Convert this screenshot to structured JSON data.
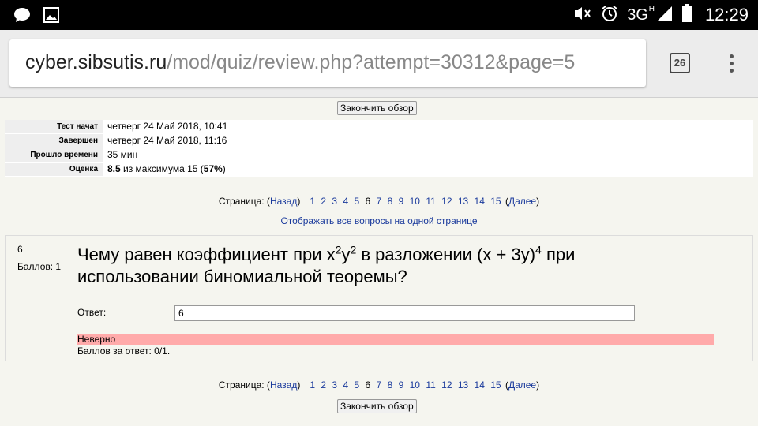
{
  "statusbar": {
    "network": "3G",
    "network_sup": "H",
    "battery": "16",
    "time": "12:29",
    "icons": [
      "message-icon",
      "image-icon",
      "mute-icon",
      "alarm-icon",
      "signal-icon",
      "battery-icon"
    ]
  },
  "browser": {
    "url_host": "cyber.sibsutis.ru",
    "url_path": "/mod/quiz/review.php?attempt=30312&page=5",
    "tabs_count": "26"
  },
  "quiz": {
    "finish_review": "Закончить обзор",
    "summary": [
      {
        "key": "Тест начат",
        "value": "четверг 24 Май 2018, 10:41"
      },
      {
        "key": "Завершен",
        "value": "четверг 24 Май 2018, 11:16"
      },
      {
        "key": "Прошло времени",
        "value": "35 мин"
      }
    ],
    "grade_key": "Оценка",
    "grade_score": "8.5",
    "grade_text_mid": " из максимума 15 (",
    "grade_percent": "57%",
    "grade_text_end": ")",
    "pager": {
      "label": "Страница: (",
      "prev": "Назад",
      "next": "Далее",
      "close_paren": ")",
      "open_paren": " (",
      "pages": [
        "1",
        "2",
        "3",
        "4",
        "5",
        "6",
        "7",
        "8",
        "9",
        "10",
        "11",
        "12",
        "13",
        "14",
        "15"
      ],
      "current": "6"
    },
    "show_all": "Отображать все вопросы на одной странице",
    "question": {
      "number": "6",
      "marks": "Баллов: 1",
      "text_a": "Чему равен коэффициент при x",
      "sup1": "2",
      "text_b": "y",
      "sup2": "2",
      "text_c": " в разложении (x + 3y)",
      "sup3": "4",
      "text_d": " при использовании биномиальной теоремы?",
      "answer_label": "Ответ:",
      "answer_value": "6",
      "feedback": "Неверно",
      "score": "Баллов за ответ: 0/1."
    }
  },
  "colors": {
    "link": "#1a3a9c",
    "wrong_bg": "#ffaaaa",
    "page_bg": "#f5f5ef"
  }
}
